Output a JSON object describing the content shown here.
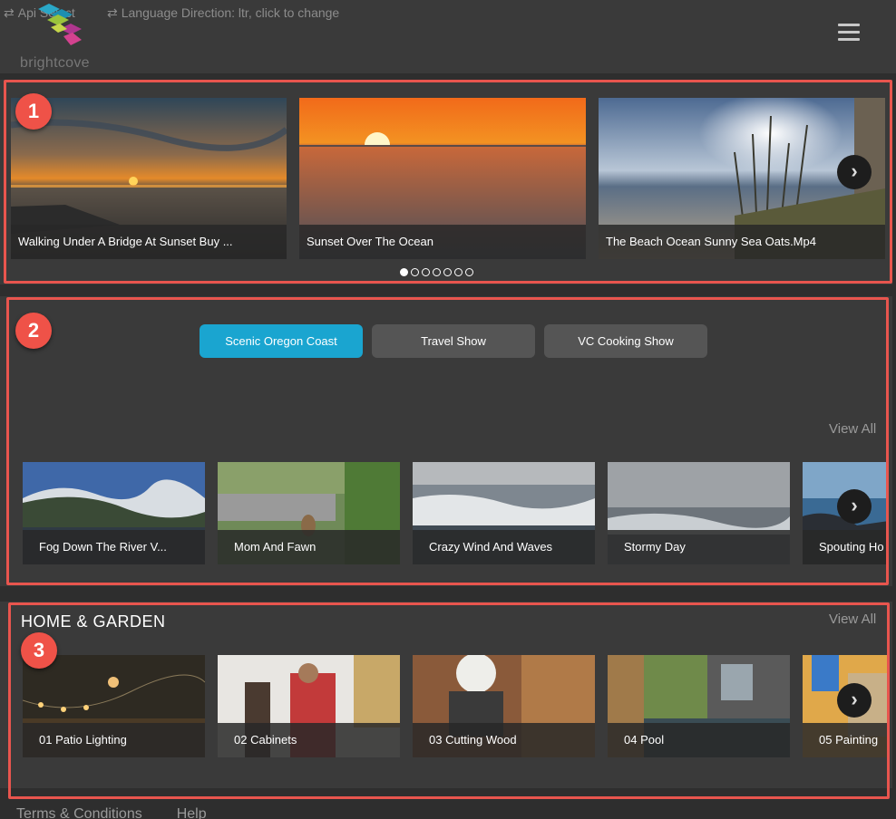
{
  "header": {
    "api_link": "Api Select",
    "language_link": "Language Direction: ltr, click to change",
    "logo_text": "brightcove"
  },
  "featured": {
    "badge": "1",
    "slides": [
      {
        "title": "Walking Under A Bridge At Sunset Buy ..."
      },
      {
        "title": "Sunset Over The Ocean"
      },
      {
        "title": "The Beach Ocean Sunny Sea Oats.Mp4"
      }
    ],
    "dots_total": 7,
    "dots_active": 1
  },
  "playlists": {
    "badge": "2",
    "tabs": [
      {
        "label": "Scenic Oregon Coast",
        "active": true
      },
      {
        "label": "Travel Show",
        "active": false
      },
      {
        "label": "VC Cooking Show",
        "active": false
      }
    ],
    "view_all": "View All",
    "videos": [
      {
        "title": "Fog Down The River V..."
      },
      {
        "title": "Mom And Fawn"
      },
      {
        "title": "Crazy Wind And Waves"
      },
      {
        "title": "Stormy Day"
      },
      {
        "title": "Spouting Ho"
      }
    ]
  },
  "home_garden": {
    "badge": "3",
    "title": "HOME & GARDEN",
    "view_all": "View All",
    "videos": [
      {
        "title": "01 Patio Lighting"
      },
      {
        "title": "02 Cabinets"
      },
      {
        "title": "03 Cutting Wood"
      },
      {
        "title": "04 Pool"
      },
      {
        "title": "05 Painting"
      }
    ]
  },
  "footer": {
    "terms": "Terms & Conditions",
    "help": "Help"
  },
  "colors": {
    "accent": "#1aa5d0",
    "annotation": "#e8554e",
    "background": "#2e2e2e",
    "panel": "#3a3a3a"
  }
}
